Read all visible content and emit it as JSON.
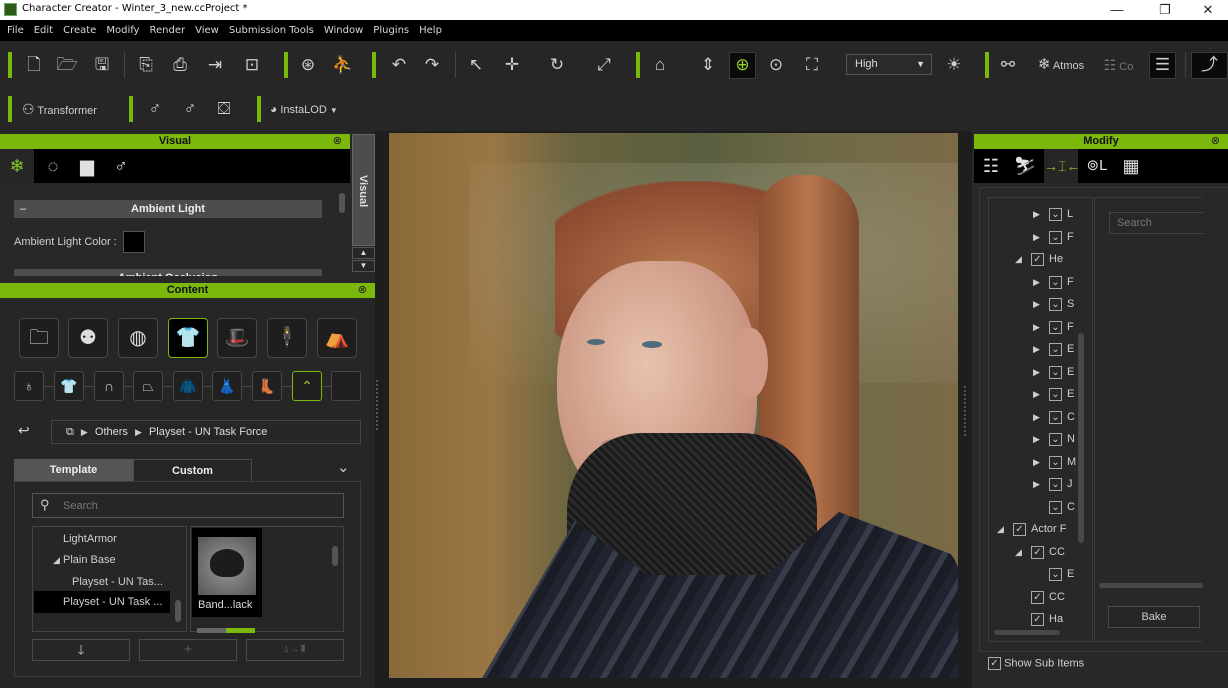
{
  "window": {
    "title": "Character Creator - Winter_3_new.ccProject *",
    "controls": {
      "minimize": "—",
      "restore": "❐",
      "close": "✕"
    }
  },
  "menu": [
    "File",
    "Edit",
    "Create",
    "Modify",
    "Render",
    "View",
    "Submission Tools",
    "Window",
    "Plugins",
    "Help"
  ],
  "toolbar": {
    "quality_dropdown": "High",
    "atmos_label": "Atmos",
    "co_label": "Co",
    "transformer_label": "Transformer",
    "instalod_label": "InstaLOD",
    "accent_color": "#78b80a"
  },
  "visual_panel": {
    "title": "Visual",
    "side_tab": "Visual",
    "section1": "Ambient Light",
    "ambient_color_label": "Ambient Light Color :",
    "ambient_color": "#000000",
    "section2": "Ambient Occlusion"
  },
  "content_panel": {
    "title": "Content",
    "breadcrumb": [
      "Others",
      "Playset - UN Task Force"
    ],
    "tabs": {
      "template": "Template",
      "custom": "Custom"
    },
    "search_placeholder": "Search",
    "tree": [
      {
        "label": "LightArmor",
        "expanded": null,
        "selected": false
      },
      {
        "label": "Plain Base",
        "expanded": true,
        "selected": false
      },
      {
        "label": "Playset - UN Tas...",
        "expanded": null,
        "selected": false
      },
      {
        "label": "Playset - UN Task ...",
        "expanded": null,
        "selected": true
      }
    ],
    "thumbnail_label": "Band...lack"
  },
  "modify_panel": {
    "title": "Modify",
    "search_placeholder": "Search",
    "tree": [
      {
        "label": "L",
        "checked": "partial"
      },
      {
        "label": "F",
        "checked": "partial"
      },
      {
        "label": "He",
        "checked": "full"
      },
      {
        "label": "F",
        "checked": "partial"
      },
      {
        "label": "S",
        "checked": "partial"
      },
      {
        "label": "F",
        "checked": "partial"
      },
      {
        "label": "E",
        "checked": "partial"
      },
      {
        "label": "E",
        "checked": "partial"
      },
      {
        "label": "E",
        "checked": "partial"
      },
      {
        "label": "C",
        "checked": "partial"
      },
      {
        "label": "N",
        "checked": "partial"
      },
      {
        "label": "M",
        "checked": "partial"
      },
      {
        "label": "J",
        "checked": "partial"
      },
      {
        "label": "C",
        "checked": "partial"
      },
      {
        "label": "Actor F",
        "checked": "full"
      },
      {
        "label": "CC",
        "checked": "full"
      },
      {
        "label": "E",
        "checked": "partial"
      },
      {
        "label": "CC",
        "checked": "full"
      },
      {
        "label": "Ha",
        "checked": "full"
      }
    ],
    "bake_label": "Bake",
    "show_sub_items_label": "Show Sub Items",
    "show_sub_items_checked": true
  }
}
